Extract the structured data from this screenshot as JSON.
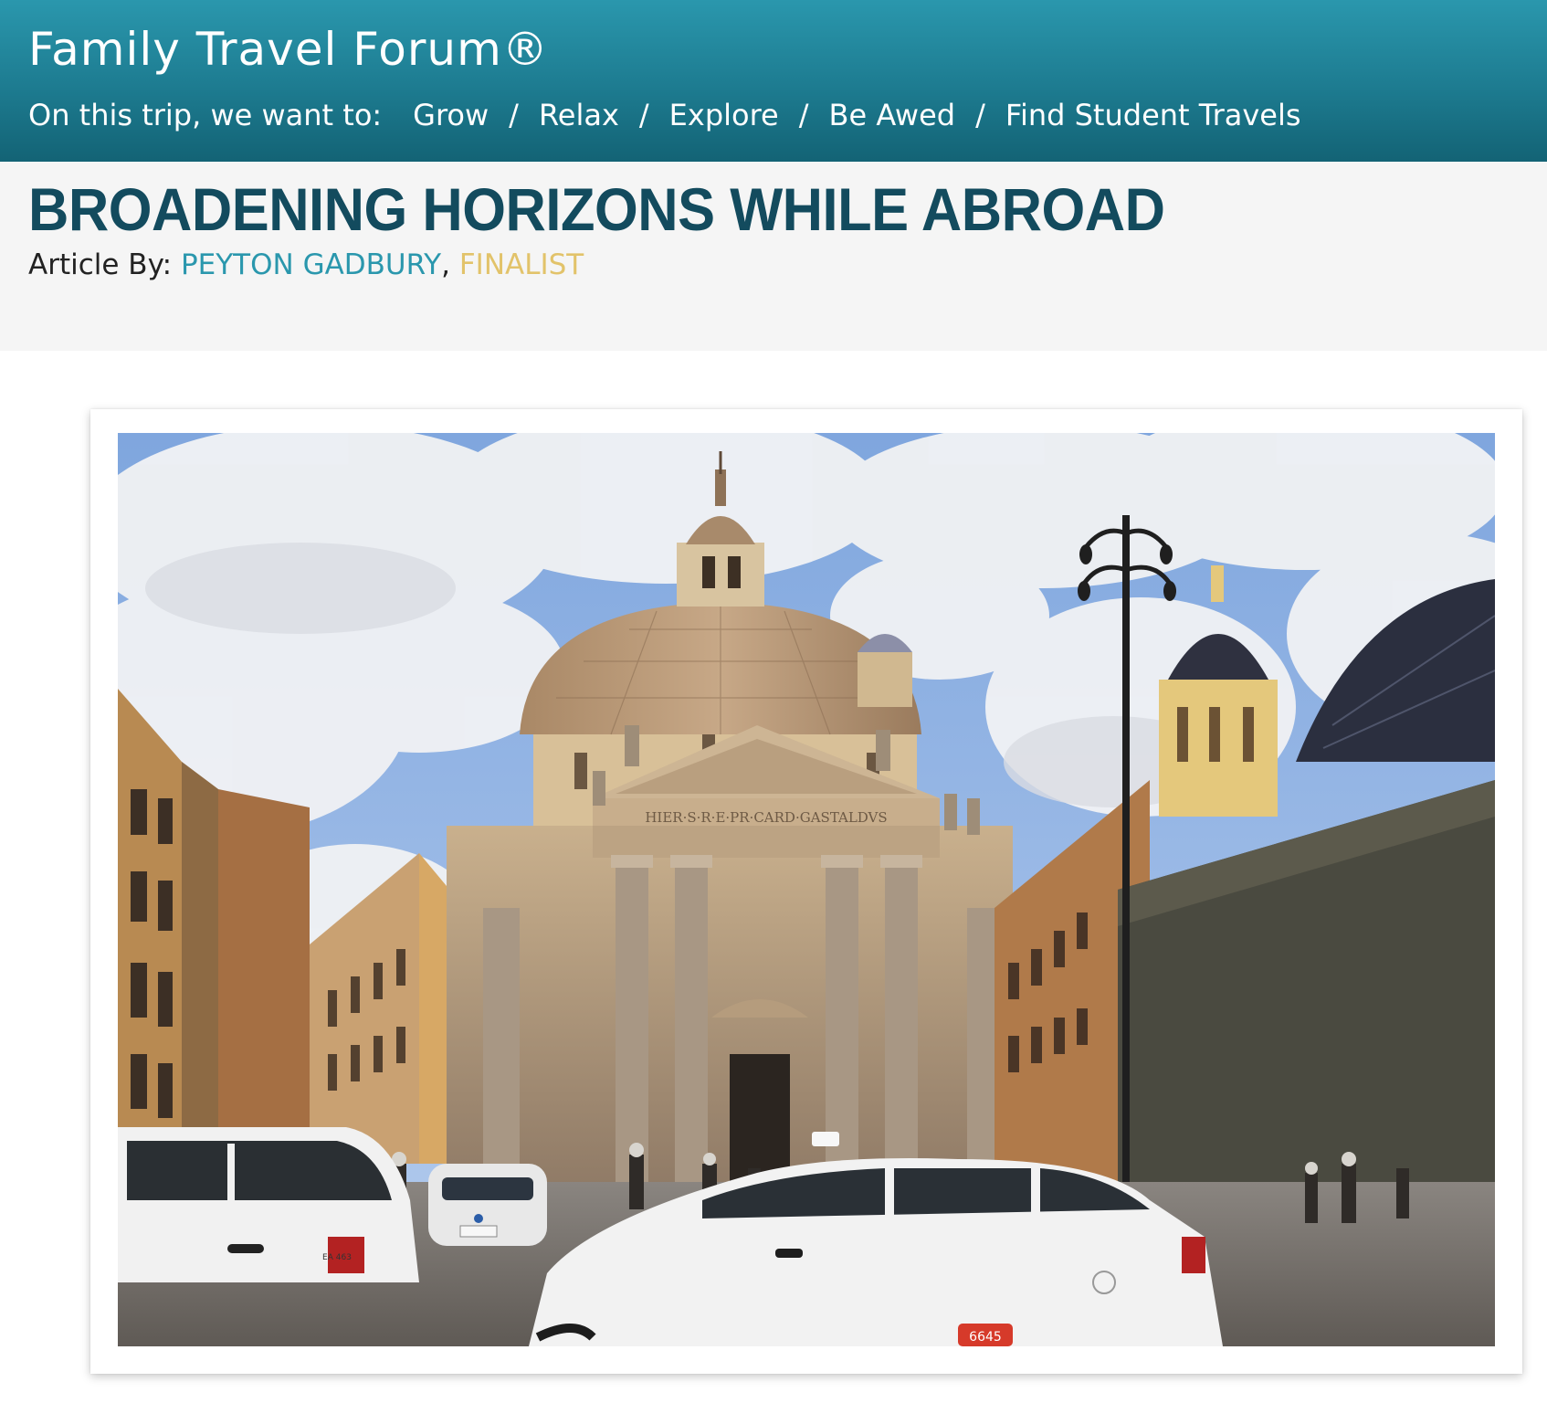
{
  "header": {
    "site_title": "Family Travel Forum®",
    "trip_prompt": "On this trip, we want to:",
    "nav": [
      {
        "label": "Grow"
      },
      {
        "label": "Relax"
      },
      {
        "label": "Explore"
      },
      {
        "label": "Be Awed"
      },
      {
        "label": "Find Student Travels"
      }
    ],
    "separator": "/"
  },
  "article": {
    "title": "BROADENING HORIZONS WHILE ABROAD",
    "byline_prefix": "Article By:",
    "author": "PEYTON GADBURY",
    "byline_comma": ",",
    "award": "FINALIST"
  },
  "photo": {
    "inscription": "HIER·S·R·E·PR·CARD·GASTALDVS",
    "plate_left": "EA 463",
    "plate_taxi": "6645"
  },
  "colors": {
    "header_teal": "#1d7b90",
    "title_navy": "#134b5e",
    "author_teal": "#2a97ad",
    "finalist_gold": "#e2c36a",
    "band_gray": "#f5f5f5"
  }
}
